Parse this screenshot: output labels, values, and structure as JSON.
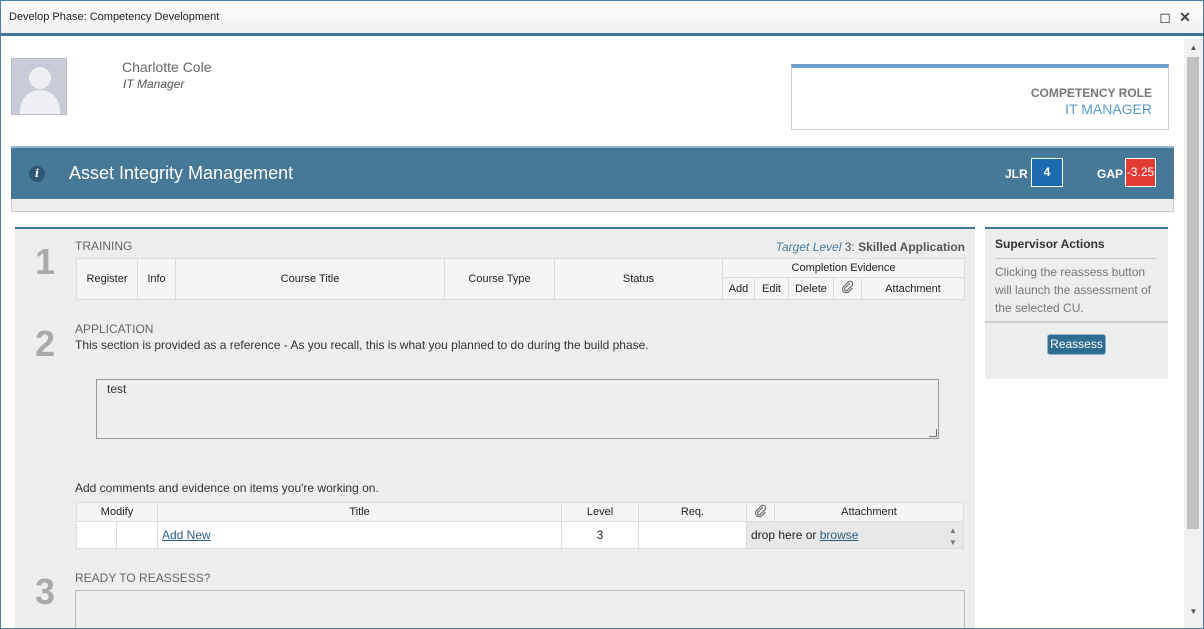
{
  "window": {
    "title": "Develop Phase: Competency Development"
  },
  "employee": {
    "name": "Charlotte Cole",
    "title": "IT Manager"
  },
  "competency_role": {
    "label": "COMPETENCY ROLE",
    "value": "IT MANAGER"
  },
  "banner": {
    "title": "Asset Integrity Management",
    "jlr_label": "JLR",
    "jlr_value": "4",
    "gap_label": "GAP",
    "gap_value": "-3.25",
    "colors": {
      "jlr": "#1b6bb0",
      "gap": "#e23c35"
    }
  },
  "training": {
    "number": "1",
    "heading": "TRAINING",
    "target_prefix": "Target Level",
    "target_level": "3",
    "target_name": "Skilled Application",
    "columns": {
      "register": "Register",
      "info": "Info",
      "course_title": "Course Title",
      "course_type": "Course Type",
      "status": "Status",
      "completion_evidence": "Completion Evidence",
      "add": "Add",
      "edit": "Edit",
      "delete": "Delete",
      "attachment": "Attachment"
    }
  },
  "application": {
    "number": "2",
    "heading": "APPLICATION",
    "description": "This section is provided as a reference - As you recall, this is what you planned to do during the build phase.",
    "plan_text": "test",
    "comments_prompt": "Add comments and evidence on items you're working on.",
    "columns": {
      "modify": "Modify",
      "title": "Title",
      "level": "Level",
      "req": "Req.",
      "attachment": "Attachment"
    },
    "row": {
      "add_new": "Add New",
      "level": "3",
      "drop_text": "drop here or",
      "browse": "browse"
    }
  },
  "ready": {
    "number": "3",
    "heading": "READY TO REASSESS?"
  },
  "supervisor": {
    "heading": "Supervisor Actions",
    "text": "Clicking the reassess button will launch the assessment of the selected CU.",
    "button": "Reassess"
  },
  "icons": {
    "info": "info-icon",
    "maximize": "maximize-icon",
    "close": "close-icon",
    "attachment": "paperclip-icon"
  }
}
